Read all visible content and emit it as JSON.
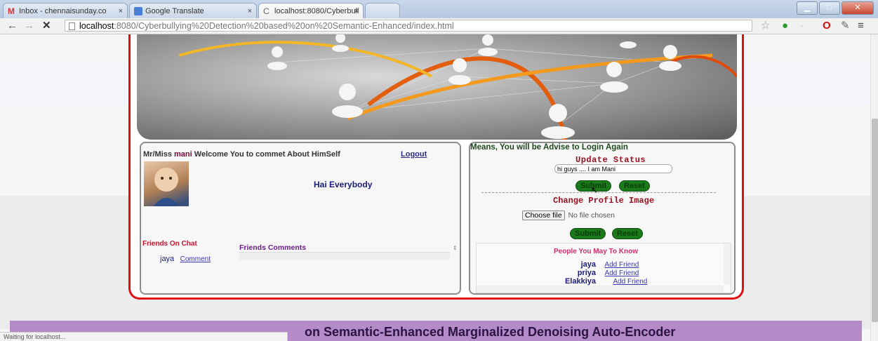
{
  "browser": {
    "tabs": [
      {
        "label": "Inbox - chennaisunday.co"
      },
      {
        "label": "Google Translate"
      },
      {
        "label": "localhost:8080/Cyberbull"
      }
    ],
    "url_host": "localhost",
    "url_rest": ":8080/Cyberbullying%20Detection%20based%20on%20Semantic-Enhanced/index.html",
    "status": "Waiting for localhost..."
  },
  "profile": {
    "greeting_prefix": "Mr/Miss",
    "username": "mani",
    "greeting_suffix": "Welcome You to commet About HimSelf",
    "logout": "Logout",
    "status_message": "Hai Everybody",
    "friends_on_chat_title": "Friends On Chat",
    "friends_comments_title": "Friends Comments",
    "chat_friends": [
      {
        "name": "jaya",
        "action": "Comment"
      }
    ]
  },
  "right": {
    "notice": "Means, You will be Advise to Login Again",
    "update_status_title": "Update Status",
    "status_value": "hi guys .... I am Mani",
    "submit": "Submit",
    "reset": "Reset",
    "change_image_title": "Change Profile Image",
    "choose_file": "Choose file",
    "no_file": "No file chosen",
    "submit2": "Submit",
    "reset2": "Reset",
    "people_title": "People You May To Know",
    "people": [
      {
        "name": "jaya",
        "action": "Add Friend"
      },
      {
        "name": "priya",
        "action": "Add Friend"
      },
      {
        "name": "Elakkiya",
        "action": "Add Friend"
      }
    ]
  },
  "footer": {
    "title": "on Semantic-Enhanced Marginalized Denoising Auto-Encoder"
  }
}
